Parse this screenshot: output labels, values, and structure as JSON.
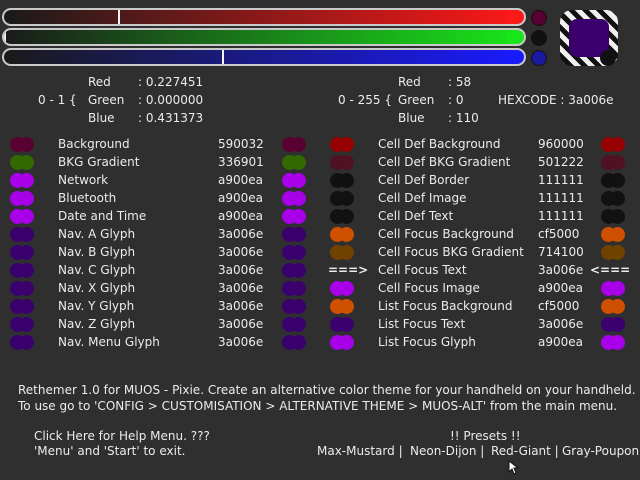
{
  "sliders": {
    "red": {
      "value": 0.227451,
      "color": "#ff1a1a"
    },
    "green": {
      "value": 0.0,
      "color": "#19e619"
    },
    "blue": {
      "value": 0.431373,
      "color": "#1a1aff"
    }
  },
  "preview": {
    "color": "#3a006e",
    "small": [
      "#590032",
      "#111111",
      "#1a1aa0"
    ]
  },
  "float_block": {
    "prefix": "0 - 1 {",
    "red_label": "Red",
    "red_value": ": 0.227451",
    "green_label": "Green",
    "green_value": ": 0.000000",
    "blue_label": "Blue",
    "blue_value": ": 0.431373"
  },
  "int_block": {
    "prefix": "0 - 255 {",
    "red_label": "Red",
    "red_value": ": 58",
    "green_label": "Green",
    "green_value": ": 0",
    "blue_label": "Blue",
    "blue_value": ": 110",
    "hexcode": "HEXCODE : 3a006e"
  },
  "left_items": [
    {
      "label": "Background",
      "hex": "590032",
      "color": "#590032"
    },
    {
      "label": "BKG Gradient",
      "hex": "336901",
      "color": "#336901"
    },
    {
      "label": "Network",
      "hex": "a900ea",
      "color": "#a900ea"
    },
    {
      "label": "Bluetooth",
      "hex": "a900ea",
      "color": "#a900ea"
    },
    {
      "label": "Date and Time",
      "hex": "a900ea",
      "color": "#a900ea"
    },
    {
      "label": "Nav. A Glyph",
      "hex": "3a006e",
      "color": "#3a006e"
    },
    {
      "label": "Nav. B Glyph",
      "hex": "3a006e",
      "color": "#3a006e"
    },
    {
      "label": "Nav. C Glyph",
      "hex": "3a006e",
      "color": "#3a006e"
    },
    {
      "label": "Nav. X Glyph",
      "hex": "3a006e",
      "color": "#3a006e"
    },
    {
      "label": "Nav. Y Glyph",
      "hex": "3a006e",
      "color": "#3a006e"
    },
    {
      "label": "Nav. Z Glyph",
      "hex": "3a006e",
      "color": "#3a006e"
    },
    {
      "label": "Nav. Menu Glyph",
      "hex": "3a006e",
      "color": "#3a006e"
    }
  ],
  "right_items": [
    {
      "label": "Cell Def Background",
      "hex": "960000",
      "color": "#960000"
    },
    {
      "label": "Cell Def BKG Gradient",
      "hex": "501222",
      "color": "#501222"
    },
    {
      "label": "Cell Def Border",
      "hex": "111111",
      "color": "#111111"
    },
    {
      "label": "Cell Def Image",
      "hex": "111111",
      "color": "#111111"
    },
    {
      "label": "Cell Def Text",
      "hex": "111111",
      "color": "#111111"
    },
    {
      "label": "Cell Focus Background",
      "hex": "cf5000",
      "color": "#cf5000"
    },
    {
      "label": "Cell Focus BKG Gradient",
      "hex": "714100",
      "color": "#714100"
    },
    {
      "label": "Cell Focus Text",
      "hex": "3a006e",
      "color": "#3a006e"
    },
    {
      "label": "Cell Focus Image",
      "hex": "a900ea",
      "color": "#a900ea"
    },
    {
      "label": "List Focus Background",
      "hex": "cf5000",
      "color": "#cf5000"
    },
    {
      "label": "List Focus Text",
      "hex": "3a006e",
      "color": "#3a006e"
    },
    {
      "label": "List Focus Glyph",
      "hex": "a900ea",
      "color": "#a900ea"
    }
  ],
  "selection_arrows": {
    "left": "===>",
    "right": "<==="
  },
  "info": {
    "line1": "Rethemer 1.0 for MUOS - Pixie. Create an alternative color theme for your handheld on your handheld.",
    "line2": "To use go to 'CONFIG > CUSTOMISATION > ALTERNATIVE THEME > MUOS-ALT' from the main menu."
  },
  "help": {
    "line1": "Click Here for Help Menu.  ???",
    "line2": "'Menu' and 'Start' to exit."
  },
  "presets": {
    "title": "!! Presets !!",
    "items": [
      "Max-Mustard |",
      "Neon-Dijon |",
      "Red-Giant |",
      "Gray-Poupon"
    ]
  }
}
